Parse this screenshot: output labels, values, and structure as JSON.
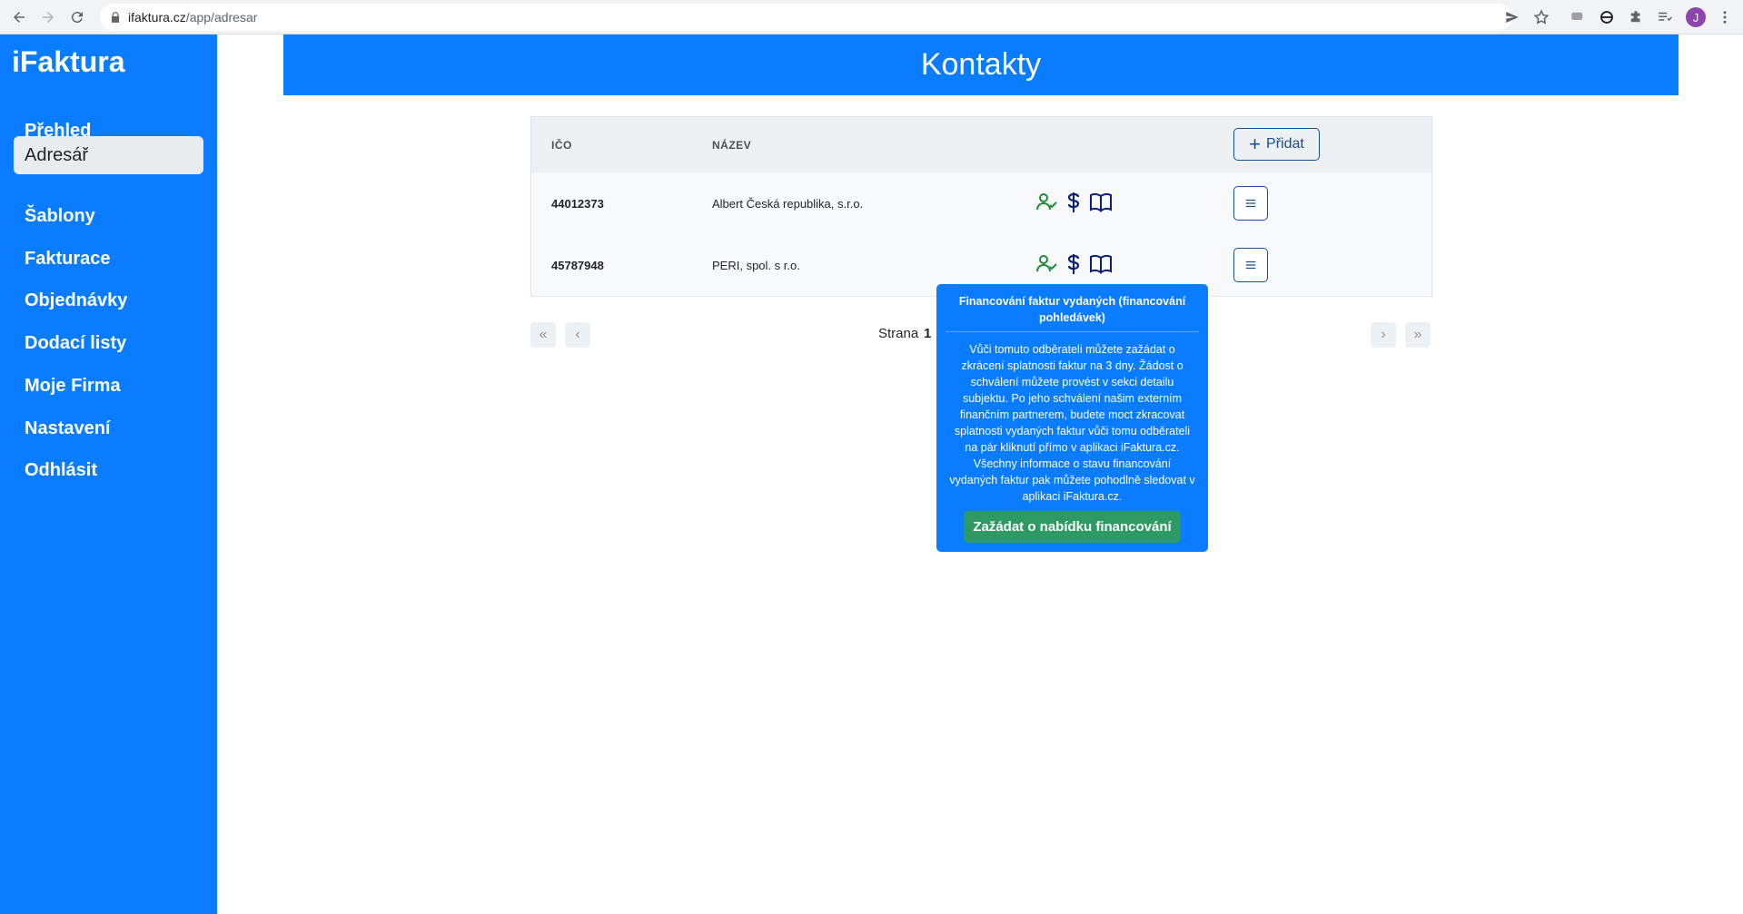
{
  "browser": {
    "url_host": "ifaktura.cz",
    "url_path": "/app/adresar",
    "profile_initial": "J"
  },
  "sidebar": {
    "brand": "iFaktura",
    "items": [
      {
        "label": "Přehled"
      },
      {
        "label": "Adresář",
        "active": true
      },
      {
        "label": "Šablony"
      },
      {
        "label": "Fakturace"
      },
      {
        "label": "Objednávky"
      },
      {
        "label": "Dodací listy"
      },
      {
        "label": "Moje Firma"
      },
      {
        "label": "Nastavení"
      },
      {
        "label": "Odhlásit"
      }
    ]
  },
  "header": {
    "title": "Kontakty"
  },
  "table": {
    "columns": [
      "IČO",
      "NÁZEV"
    ],
    "add_label": "Přidat",
    "rows": [
      {
        "ico": "44012373",
        "name": "Albert Česká republika, s.r.o."
      },
      {
        "ico": "45787948",
        "name": "PERI, spol. s r.o."
      }
    ],
    "row_icons": [
      "user-check-icon",
      "dollar-icon",
      "book-icon",
      "menu-icon"
    ]
  },
  "pagination": {
    "label": "Strana",
    "current": "1"
  },
  "tooltip": {
    "title": "Financování faktur vydaných (financování pohledávek)",
    "body": "Vůči tomuto odběrateli můžete zažádat o zkrácení splatnosti faktur na 3 dny. Žádost o schválení můžete provést v sekci detailu subjektu. Po jeho schválení našim externím finančním partnerem, budete moct zkracovat splatnosti vydaných faktur vůči tomu odběrateli na pár kliknutí přímo v aplikaci iFaktura.cz. Všechny informace o stavu financování vydaných faktur pak můžete pohodlně sledovat v aplikaci iFaktura.cz.",
    "button_label": "Zažádat o nabídku financování"
  },
  "colors": {
    "brand_blue": "#0a7cff",
    "button_outline": "#1a4f8a",
    "icon_green": "#1e8c3a",
    "icon_navy": "#0b1f7a",
    "cta_green": "#2e9a63"
  }
}
